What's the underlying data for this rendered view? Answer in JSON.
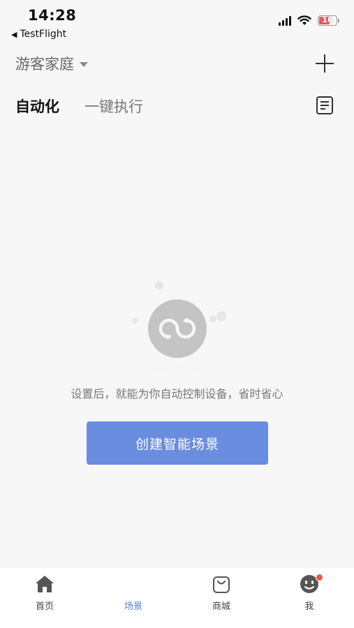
{
  "status_bar": {
    "time": "14:28",
    "back_app": "TestFlight",
    "battery_level": "16"
  },
  "header": {
    "home_name": "游客家庭"
  },
  "tabs": [
    {
      "label": "自动化",
      "active": true
    },
    {
      "label": "一键执行",
      "active": false
    }
  ],
  "empty_state": {
    "message": "设置后，就能为你自动控制设备，省时省心",
    "button_label": "创建智能场景"
  },
  "tabbar": {
    "items": [
      {
        "label": "首页",
        "icon": "home-icon",
        "active": false
      },
      {
        "label": "场景",
        "icon": "scene-icon",
        "active": true
      },
      {
        "label": "商城",
        "icon": "shopping-bag-icon",
        "active": false
      },
      {
        "label": "我",
        "icon": "profile-icon",
        "active": false,
        "badge": true
      }
    ]
  },
  "colors": {
    "accent": "#6a8de0",
    "active_tab": "#5b7bd5",
    "badge": "#e8544f",
    "background": "#f7f7f7"
  }
}
